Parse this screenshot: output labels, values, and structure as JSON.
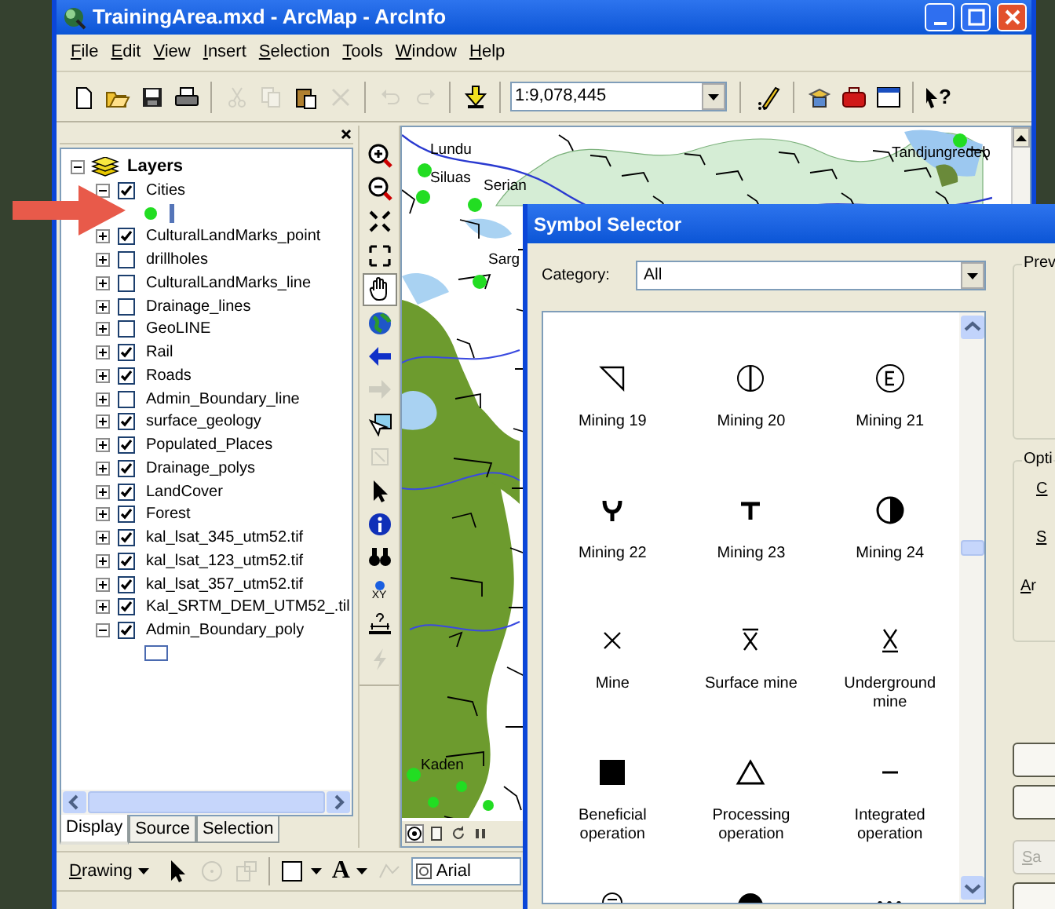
{
  "window": {
    "title": "TrainingArea.mxd - ArcMap - ArcInfo"
  },
  "menu": [
    "File",
    "Edit",
    "View",
    "Insert",
    "Selection",
    "Tools",
    "Window",
    "Help"
  ],
  "toolbar": {
    "tools_left": [
      {
        "kind": "new",
        "disabled": false
      },
      {
        "kind": "open",
        "disabled": false
      },
      {
        "kind": "save",
        "disabled": false
      },
      {
        "kind": "print",
        "disabled": false
      },
      {
        "kind": "cut",
        "disabled": true
      },
      {
        "kind": "copy",
        "disabled": true
      },
      {
        "kind": "paste",
        "disabled": false
      },
      {
        "kind": "delete",
        "disabled": true
      },
      {
        "kind": "undo",
        "disabled": true
      },
      {
        "kind": "redo",
        "disabled": true
      },
      {
        "kind": "add-data",
        "disabled": false
      }
    ],
    "scale": "1:9,078,445",
    "tools_right": [
      {
        "kind": "editor",
        "disabled": false
      },
      {
        "kind": "catalog",
        "disabled": false
      },
      {
        "kind": "toolbox",
        "disabled": false
      },
      {
        "kind": "command",
        "disabled": false
      },
      {
        "kind": "whats-this",
        "label": "?",
        "disabled": false
      }
    ]
  },
  "toc": {
    "root": {
      "label": "Layers",
      "expanded": true,
      "children": [
        {
          "label": "Cities",
          "checked": true,
          "expanded": true,
          "legend": {
            "kind": "point"
          }
        },
        {
          "label": "CulturalLandMarks_point",
          "checked": true,
          "expanded": false
        },
        {
          "label": "drillholes",
          "checked": false,
          "expanded": false
        },
        {
          "label": "CulturalLandMarks_line",
          "checked": false,
          "expanded": false
        },
        {
          "label": "Drainage_lines",
          "checked": false,
          "expanded": false
        },
        {
          "label": "GeoLINE",
          "checked": false,
          "expanded": false
        },
        {
          "label": "Rail",
          "checked": true,
          "expanded": false
        },
        {
          "label": "Roads",
          "checked": true,
          "expanded": false
        },
        {
          "label": "Admin_Boundary_line",
          "checked": false,
          "expanded": false
        },
        {
          "label": "surface_geology",
          "checked": true,
          "expanded": false
        },
        {
          "label": "Populated_Places",
          "checked": true,
          "expanded": false
        },
        {
          "label": "Drainage_polys",
          "checked": true,
          "expanded": false
        },
        {
          "label": "LandCover",
          "checked": true,
          "expanded": false
        },
        {
          "label": "Forest",
          "checked": true,
          "expanded": false
        },
        {
          "label": "kal_lsat_345_utm52.tif",
          "checked": true,
          "expanded": false
        },
        {
          "label": "kal_lsat_123_utm52.tif",
          "checked": true,
          "expanded": false
        },
        {
          "label": "kal_lsat_357_utm52.tif",
          "checked": true,
          "expanded": false
        },
        {
          "label": "Kal_SRTM_DEM_UTM52_.til",
          "checked": true,
          "expanded": false
        },
        {
          "label": "Admin_Boundary_poly",
          "checked": true,
          "expanded": true,
          "legend": {
            "kind": "polygon"
          }
        }
      ]
    },
    "tabs": [
      {
        "label": "Display",
        "selected": true
      },
      {
        "label": "Source",
        "selected": false
      },
      {
        "label": "Selection",
        "selected": false
      }
    ]
  },
  "tools": [
    {
      "kind": "zoom-in",
      "selected": false,
      "disabled": false
    },
    {
      "kind": "zoom-out",
      "selected": false,
      "disabled": false
    },
    {
      "kind": "fixed-in",
      "selected": false,
      "disabled": false
    },
    {
      "kind": "fixed-out",
      "selected": false,
      "disabled": false
    },
    {
      "kind": "pan",
      "selected": true,
      "disabled": false
    },
    {
      "kind": "globe",
      "selected": false,
      "disabled": false
    },
    {
      "kind": "back",
      "selected": false,
      "disabled": false
    },
    {
      "kind": "forward",
      "selected": false,
      "disabled": true
    },
    {
      "kind": "select-elements",
      "selected": false,
      "disabled": false
    },
    {
      "kind": "blank",
      "selected": false,
      "disabled": true
    },
    {
      "kind": "pointer",
      "selected": false,
      "disabled": false
    },
    {
      "kind": "info",
      "selected": false,
      "disabled": false
    },
    {
      "kind": "find",
      "selected": false,
      "disabled": false
    },
    {
      "kind": "go-xy",
      "label": "XY",
      "selected": false,
      "disabled": false
    },
    {
      "kind": "measure",
      "selected": false,
      "disabled": false
    },
    {
      "kind": "hyperlink",
      "selected": false,
      "disabled": true
    }
  ],
  "map": {
    "cities": [
      {
        "label": "Lundu"
      },
      {
        "label": "Siluas"
      },
      {
        "label": "Serian"
      },
      {
        "label": "Sarg"
      },
      {
        "label": "Tandjungredeb"
      },
      {
        "label": "Kaden"
      }
    ],
    "view_buttons": [
      {
        "kind": "data-view",
        "selected": true
      },
      {
        "kind": "layout-view",
        "selected": false
      },
      {
        "kind": "refresh",
        "selected": false
      },
      {
        "kind": "pause",
        "selected": false
      }
    ]
  },
  "drawing_toolbar": {
    "menu": "Drawing",
    "tools": [
      {
        "kind": "pointer",
        "disabled": false
      },
      {
        "kind": "rotate",
        "disabled": true
      },
      {
        "kind": "zoom-element",
        "disabled": true
      },
      {
        "kind": "rectangle",
        "disabled": false
      },
      {
        "kind": "text",
        "label": "A",
        "disabled": false
      },
      {
        "kind": "edit-vertices",
        "disabled": true
      }
    ],
    "font": "Arial"
  },
  "dialog": {
    "title": "Symbol Selector",
    "category_label": "Category:",
    "category": "All",
    "symbols": [
      {
        "kind": "corner-triangle",
        "name": "Mining 19"
      },
      {
        "kind": "circle-bar",
        "name": "Mining 20"
      },
      {
        "kind": "circle-e",
        "name": "Mining 21"
      },
      {
        "kind": "fork",
        "name": "Mining 22"
      },
      {
        "kind": "tee",
        "name": "Mining 23"
      },
      {
        "kind": "half-circle",
        "name": "Mining 24"
      },
      {
        "kind": "cross",
        "name": "Mine"
      },
      {
        "kind": "cross-top",
        "name": "Surface mine"
      },
      {
        "kind": "cross-bottom",
        "name": "Underground mine"
      },
      {
        "kind": "square",
        "name": "Beneficial operation"
      },
      {
        "kind": "triangle",
        "name": "Processing operation"
      },
      {
        "kind": "dash",
        "name": "Integrated operation"
      },
      {
        "kind": "circle-cut"
      },
      {
        "kind": "dome"
      },
      {
        "kind": "dots"
      }
    ],
    "preview_label": "Prev",
    "options_label": "Opti",
    "options": [
      "C",
      "S",
      "Ar"
    ],
    "buttons": [
      {
        "disabled": false
      },
      {
        "disabled": false
      },
      {
        "label": "Sa",
        "disabled": true
      },
      {
        "disabled": false
      }
    ]
  }
}
